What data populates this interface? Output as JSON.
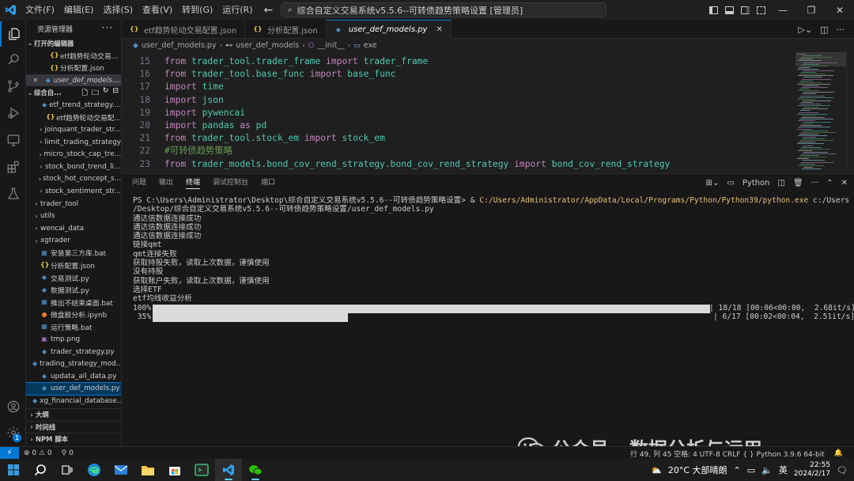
{
  "titlebar": {
    "menu": [
      "文件(F)",
      "编辑(E)",
      "选择(S)",
      "查看(V)",
      "转到(G)",
      "运行(R)"
    ],
    "more": "···",
    "search_text": "综合自定义交易系统v5.5.6--可转债趋势策略设置 [管理员]"
  },
  "sidebar": {
    "header": "资源管理器",
    "open_editors_label": "打开的编辑器",
    "open_editors": [
      {
        "name": "etf趋势轮动交易...",
        "icon": "json"
      },
      {
        "name": "分析配置.json",
        "icon": "json"
      },
      {
        "name": "user_def_models....",
        "icon": "py"
      }
    ],
    "project_label": "综合自...",
    "files": [
      {
        "name": "etf_trend_strategy....",
        "icon": "py",
        "indent": 2,
        "chev": ""
      },
      {
        "name": "etf趋势轮动交易配...",
        "icon": "json",
        "indent": 2,
        "chev": ""
      },
      {
        "name": "joinquant_trader_str...",
        "icon": "folder",
        "indent": 1,
        "chev": "›"
      },
      {
        "name": "limit_trading_strategy",
        "icon": "folder",
        "indent": 1,
        "chev": "›"
      },
      {
        "name": "micro_stock_cap_tre...",
        "icon": "folder",
        "indent": 1,
        "chev": "›"
      },
      {
        "name": "stock_bond_trend_li...",
        "icon": "folder",
        "indent": 1,
        "chev": "›"
      },
      {
        "name": "stock_hot_concept_s...",
        "icon": "folder",
        "indent": 1,
        "chev": "›"
      },
      {
        "name": "stock_sentiment_str...",
        "icon": "folder",
        "indent": 1,
        "chev": "›"
      },
      {
        "name": "trader_tool",
        "icon": "folder",
        "indent": 0,
        "chev": "›"
      },
      {
        "name": "utils",
        "icon": "folder",
        "indent": 0,
        "chev": "›"
      },
      {
        "name": "wencai_data",
        "icon": "folder",
        "indent": 0,
        "chev": "›"
      },
      {
        "name": "xgtrader",
        "icon": "folder",
        "indent": 0,
        "chev": "›"
      },
      {
        "name": "安装第三方库.bat",
        "icon": "bat",
        "indent": 0,
        "chev": ""
      },
      {
        "name": "分析配置.json",
        "icon": "json",
        "indent": 0,
        "chev": ""
      },
      {
        "name": "交易测试.py",
        "icon": "py",
        "indent": 0,
        "chev": ""
      },
      {
        "name": "数据测试.py",
        "icon": "py",
        "indent": 0,
        "chev": ""
      },
      {
        "name": "推出不结束桌面.bat",
        "icon": "bat",
        "indent": 0,
        "chev": ""
      },
      {
        "name": "微盘股分析.ipynb",
        "icon": "nb",
        "indent": 0,
        "chev": ""
      },
      {
        "name": "运行策略.bat",
        "icon": "bat",
        "indent": 0,
        "chev": ""
      },
      {
        "name": "tmp.png",
        "icon": "png",
        "indent": 0,
        "chev": ""
      },
      {
        "name": "trader_strategy.py",
        "icon": "py",
        "indent": 0,
        "chev": ""
      },
      {
        "name": "trading_strategy_mod...",
        "icon": "py",
        "indent": 0,
        "chev": ""
      },
      {
        "name": "updata_all_data.py",
        "icon": "py",
        "indent": 0,
        "chev": ""
      },
      {
        "name": "user_def_models.py",
        "icon": "py",
        "indent": 0,
        "chev": "",
        "selected": true
      },
      {
        "name": "xg_financial_database...",
        "icon": "py",
        "indent": 0,
        "chev": ""
      }
    ],
    "bottom_sections": [
      "大纲",
      "时间线",
      "NPM 脚本"
    ]
  },
  "tabs": [
    {
      "label": "etf趋势轮动交易配置.json",
      "icon": "json",
      "active": false
    },
    {
      "label": "分析配置.json",
      "icon": "json",
      "active": false
    },
    {
      "label": "user_def_models.py",
      "icon": "py",
      "active": true
    }
  ],
  "breadcrumb": [
    "user_def_models.py",
    "user_def_models",
    "__init__",
    "exe"
  ],
  "code": [
    {
      "n": "15",
      "tokens": [
        [
          "kw",
          "from "
        ],
        [
          "mod",
          "trader_tool.trader_frame"
        ],
        [
          "kw",
          " import "
        ],
        [
          "mod",
          "trader_frame"
        ]
      ]
    },
    {
      "n": "16",
      "tokens": [
        [
          "kw",
          "from "
        ],
        [
          "mod",
          "trader_tool.base_func"
        ],
        [
          "kw",
          " import "
        ],
        [
          "mod",
          "base_func"
        ]
      ]
    },
    {
      "n": "17",
      "tokens": [
        [
          "kw",
          "import "
        ],
        [
          "mod",
          "time"
        ]
      ]
    },
    {
      "n": "18",
      "tokens": [
        [
          "kw",
          "import "
        ],
        [
          "mod",
          "json"
        ]
      ]
    },
    {
      "n": "19",
      "tokens": [
        [
          "kw",
          "import "
        ],
        [
          "mod",
          "pywencai"
        ]
      ]
    },
    {
      "n": "20",
      "tokens": [
        [
          "kw",
          "import "
        ],
        [
          "mod",
          "pandas"
        ],
        [
          "kw",
          " as "
        ],
        [
          "mod",
          "pd"
        ]
      ]
    },
    {
      "n": "21",
      "tokens": [
        [
          "kw",
          "from "
        ],
        [
          "mod",
          "trader_tool.stock_em"
        ],
        [
          "kw",
          " import "
        ],
        [
          "mod",
          "stock_em"
        ]
      ]
    },
    {
      "n": "22",
      "tokens": [
        [
          "cmt",
          "#可转债趋势策略"
        ]
      ]
    },
    {
      "n": "23",
      "tokens": [
        [
          "kw",
          "from "
        ],
        [
          "mod",
          "trader_models.bond_cov_rend_strategy.bond_cov_rend_strategy"
        ],
        [
          "kw",
          " import "
        ],
        [
          "mod",
          "bond_cov_rend_strategy"
        ]
      ]
    }
  ],
  "panel": {
    "tabs": [
      "问题",
      "输出",
      "终端",
      "调试控制台",
      "端口"
    ],
    "active_tab": "终端",
    "shell_label": "Python"
  },
  "terminal": {
    "prompt": "PS C:\\Users\\Administrator\\Desktop\\综合自定义交易系统v5.5.6--可转债趋势策略设置> & ",
    "python_path": "C:/Users/Administrator/AppData/Local/Programs/Python/Python39/python.exe",
    "arg_line1": " c:/Users/Administrator",
    "arg_line2": "/Desktop/综合自定义交易系统v5.5.6--可转债趋势策略设置/user_def_models.py",
    "lines": [
      "通达信数据连接成功",
      "通达信数据连接成功",
      "通达信数据连接成功",
      "链接qmt",
      "qmt连接失败",
      "获取持股失败，读取上次数据，谨慎使用",
      "没有持股",
      "获取账户失败，读取上次数据，谨慎使用",
      "选择ETF",
      "etf均线收益分析"
    ],
    "progress": [
      {
        "pct_label": "100%|",
        "fraction": 1.0,
        "info": "| 18/18 [00:06<00:00,  2.68it/s]"
      },
      {
        "pct_label": " 35%|",
        "fraction": 0.35,
        "info": "| 6/17 [00:02<00:04,  2.51it/s]"
      }
    ]
  },
  "watermark": "公众号 · 数据分析与运用",
  "statusbar": {
    "problems": "⊗ 0 ⚠ 0",
    "ports": "⚲ 0",
    "right": "行 49, 列 45   空格: 4   UTF-8   CRLF   { } Python   3.9.6 64-bit"
  },
  "taskbar": {
    "weather": "20°C 大部晴朗",
    "lang": "英",
    "time": "22:55",
    "date": "2024/2/17"
  },
  "colors": {
    "accent": "#0078d4",
    "keyword": "#c586c0",
    "module": "#4ec9b0",
    "comment": "#6a9955"
  }
}
